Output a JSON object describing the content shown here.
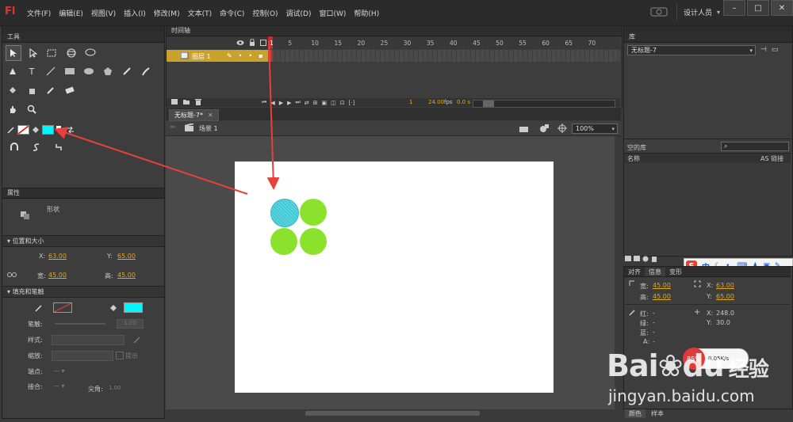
{
  "app": {
    "logo": "Fl",
    "workspace": "设计人员",
    "workspace_caret": "▾"
  },
  "menus": [
    "文件(F)",
    "编辑(E)",
    "视图(V)",
    "插入(I)",
    "修改(M)",
    "文本(T)",
    "命令(C)",
    "控制(O)",
    "调试(D)",
    "窗口(W)",
    "帮助(H)"
  ],
  "window_controls": [
    "–",
    "□",
    "✕"
  ],
  "tools_panel": {
    "title": "工具"
  },
  "properties": {
    "title": "属性",
    "shape_label": "形状",
    "position_size": {
      "header": "位置和大小",
      "x_label": "X:",
      "x_value": "63.00",
      "y_label": "Y:",
      "y_value": "65.00",
      "w_label": "宽:",
      "w_value": "45.00",
      "h_label": "高:",
      "h_value": "45.00"
    },
    "fill_stroke": {
      "header": "填充和笔触",
      "fill_color": "#00f6ff",
      "stroke_label": "笔触:",
      "stroke_value": "1.00",
      "style_label": "样式:",
      "scale_label": "缩放:",
      "hint_label": "提示",
      "cap_label": "端点:",
      "join_label": "接合:",
      "miter_label": "尖角:",
      "miter_value": "1.00"
    }
  },
  "timeline": {
    "title": "时间轴",
    "frames": [
      "1",
      "5",
      "10",
      "15",
      "20",
      "25",
      "30",
      "35",
      "40",
      "45",
      "50",
      "55",
      "60",
      "65",
      "70"
    ],
    "layer_name": "图层 1",
    "current_frame": "1",
    "fps": "24.00",
    "fps_unit": "fps",
    "time": "0.0 s"
  },
  "document": {
    "tab": "无标题-7*",
    "scene": "场景 1",
    "zoom": "100%"
  },
  "stage_colors": {
    "selected": "#3ec9d6",
    "unselected": "#8be22d"
  },
  "library": {
    "title": "库",
    "doc_select": "无标题-7",
    "empty_label": "空的库",
    "col_name": "名称",
    "col_linkage": "AS 链接"
  },
  "info": {
    "tabs": [
      "对齐",
      "信息",
      "变形"
    ],
    "w_label": "宽:",
    "w_value": "45.00",
    "h_label": "高:",
    "h_value": "45.00",
    "x_label": "X:",
    "x_value": "63.00",
    "y_label": "Y:",
    "y_value": "65.00",
    "r_label": "红:",
    "r_value": "-",
    "g_label": "绿:",
    "g_value": "-",
    "b_label": "蓝:",
    "b_value": "-",
    "a_label": "A:",
    "a_value": "-",
    "mx_label": "X:",
    "mx_value": "248.0",
    "my_label": "Y:",
    "my_value": "30.0"
  },
  "bottom_tabs": [
    "颜色",
    "样本"
  ],
  "ime_toolbar": {
    "logo": "S",
    "mode": "中"
  },
  "speed_widget": {
    "percent": "85%",
    "speed": "0.05K/s"
  },
  "watermark": {
    "brand": "Bai",
    "paw": "du",
    "cn": "经验",
    "url": "jingyan.baidu.com"
  }
}
